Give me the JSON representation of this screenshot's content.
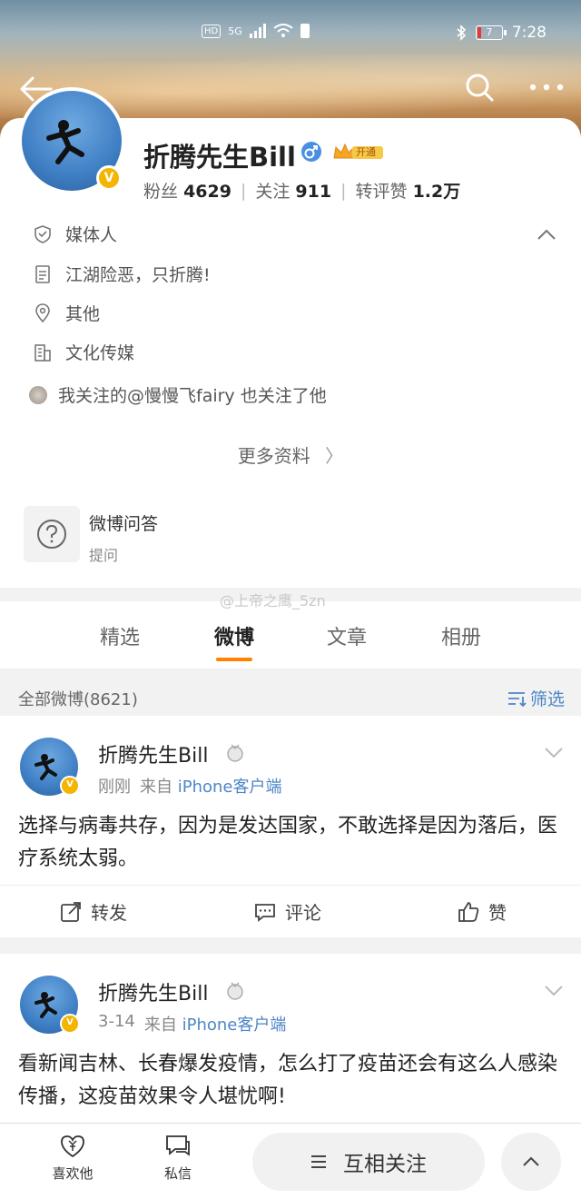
{
  "status_bar": {
    "network": "HD",
    "signal": "5G",
    "battery": "7",
    "time": "7:28"
  },
  "profile": {
    "name": "折腾先生Bill",
    "vip_label": "开通",
    "stats": [
      {
        "label": "粉丝",
        "value": "4629"
      },
      {
        "label": "关注",
        "value": "911"
      },
      {
        "label": "转评赞",
        "value": "1.2万"
      }
    ],
    "info": {
      "category": "媒体人",
      "bio": "江湖险恶，只折腾!",
      "location": "其他",
      "industry": "文化传媒",
      "mutual": "我关注的@慢慢飞fairy 也关注了他"
    },
    "more_info": "更多资料"
  },
  "qa": {
    "title": "微博问答",
    "subtitle": "提问"
  },
  "watermark": "@上帝之鹰_5zn",
  "tabs": [
    {
      "label": "精选"
    },
    {
      "label": "微博"
    },
    {
      "label": "文章"
    },
    {
      "label": "相册"
    }
  ],
  "active_tab": "微博",
  "filter_bar": {
    "all_posts": "全部微博(8621)",
    "filter": "筛选"
  },
  "posts": [
    {
      "author": "折腾先生Bill",
      "time": "刚刚",
      "source_prefix": "来自",
      "source": "iPhone客户端",
      "text": "选择与病毒共存，因为是发达国家，不敢选择是因为落后，医疗系统太弱。",
      "actions": {
        "repost": "转发",
        "comment": "评论",
        "like": "赞"
      }
    },
    {
      "author": "折腾先生Bill",
      "time": "3-14",
      "source_prefix": "来自",
      "source": "iPhone客户端",
      "text": "看新闻吉林、长春爆发疫情，怎么打了疫苗还会有这么人感染传播，这疫苗效果令人堪忧啊!"
    }
  ],
  "bottom_bar": {
    "like_him": "喜欢他",
    "message": "私信",
    "mutual_follow": "互相关注"
  },
  "colors": {
    "accent": "#ff8200",
    "link": "#4c86c7",
    "verified": "#f4b400"
  }
}
